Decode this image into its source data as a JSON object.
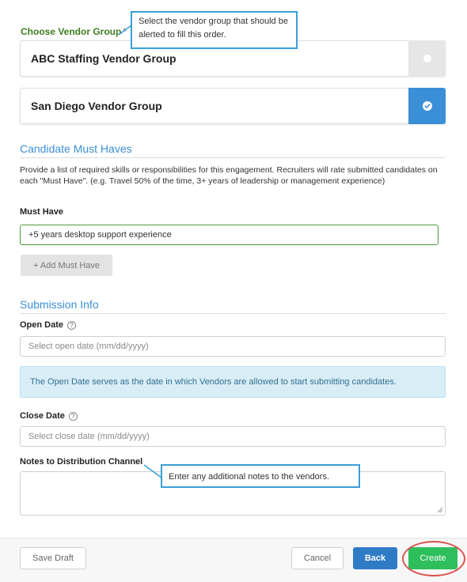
{
  "vendor_group": {
    "label": "Choose Vendor Group",
    "required_marker": "*",
    "options": [
      {
        "name": "ABC Staffing Vendor Group",
        "selected": false
      },
      {
        "name": "San Diego Vendor Group",
        "selected": true
      }
    ]
  },
  "must_haves": {
    "section_title": "Candidate Must Haves",
    "description": "Provide a list of required skills or responsibilities for this engagement. Recruiters will rate submitted candidates on each \"Must Have\". (e.g. Travel 50% of the time, 3+ years of leadership or management experience)",
    "field_label": "Must Have",
    "value": "+5 years desktop support experience",
    "add_button": "+ Add Must Have"
  },
  "submission": {
    "section_title": "Submission Info",
    "open_date_label": "Open Date",
    "open_date_placeholder": "Select open date (mm/dd/yyyy)",
    "open_date_info": "The Open Date serves as the date in which Vendors are allowed to start submitting candidates.",
    "close_date_label": "Close Date",
    "close_date_placeholder": "Select close date (mm/dd/yyyy)",
    "notes_label": "Notes to Distribution Channel",
    "help_glyph": "?"
  },
  "footer": {
    "save_draft": "Save Draft",
    "cancel": "Cancel",
    "back": "Back",
    "create": "Create"
  },
  "callouts": {
    "vendor_group": "Select the vendor group that should be alerted to fill this order.",
    "notes": "Enter any additional notes to the vendors."
  },
  "colors": {
    "accent_blue": "#3a8fd6",
    "label_green": "#3f7d20",
    "create_green": "#2ebf5c",
    "highlight_red": "#d9534f"
  },
  "icons": {
    "selected": "check-icon",
    "unselected": "radio-dot-icon",
    "help": "help-circle-icon",
    "resize": "resize-grip-icon"
  }
}
